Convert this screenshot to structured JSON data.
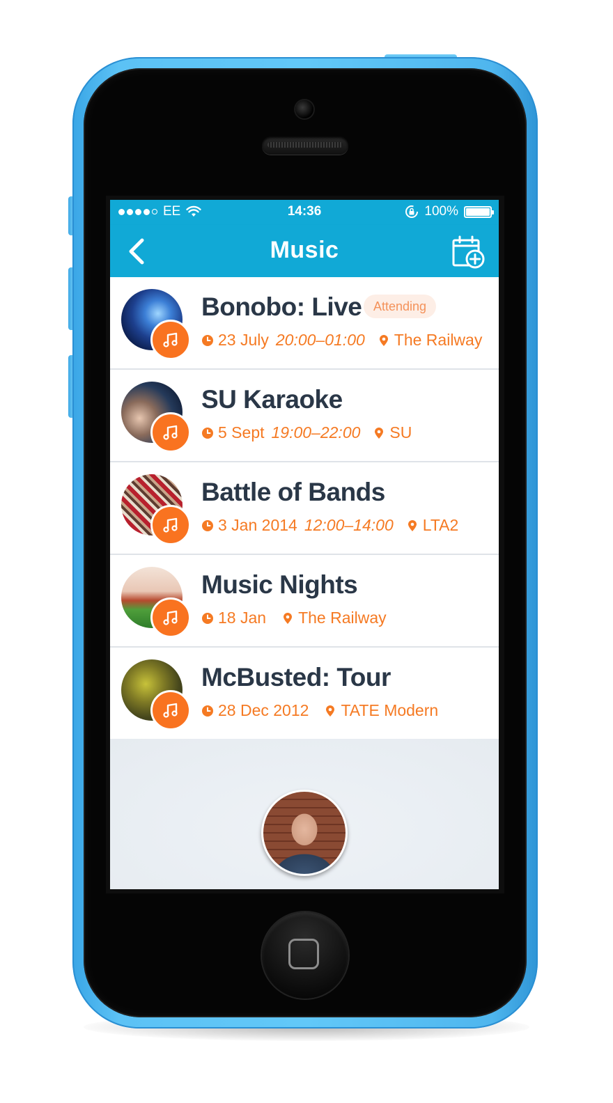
{
  "status_bar": {
    "carrier": "EE",
    "time": "14:36",
    "battery": "100%",
    "battery_level": 1.0
  },
  "nav": {
    "title": "Music",
    "back_icon": "chevron-left-icon",
    "add_icon": "calendar-add-icon"
  },
  "colors": {
    "nav_background": "#11a9d6",
    "accent_orange": "#f97320",
    "title_text": "#2a3747",
    "phone_body": "#5cc2f5"
  },
  "events": [
    {
      "title": "Bonobo: Live",
      "badge": "Attending",
      "date": "23 July",
      "time": "20:00–01:00",
      "place": "The Railway"
    },
    {
      "title": "SU Karaoke",
      "date": "5 Sept",
      "time": "19:00–22:00",
      "place": "SU"
    },
    {
      "title": "Battle of Bands",
      "date": "3 Jan 2014",
      "time": "12:00–14:00",
      "place": "LTA2"
    },
    {
      "title": "Music Nights",
      "date": "18 Jan",
      "place": "The Railway"
    },
    {
      "title": "McBusted: Tour",
      "date": "28 Dec 2012",
      "place": "TATE Modern"
    }
  ]
}
